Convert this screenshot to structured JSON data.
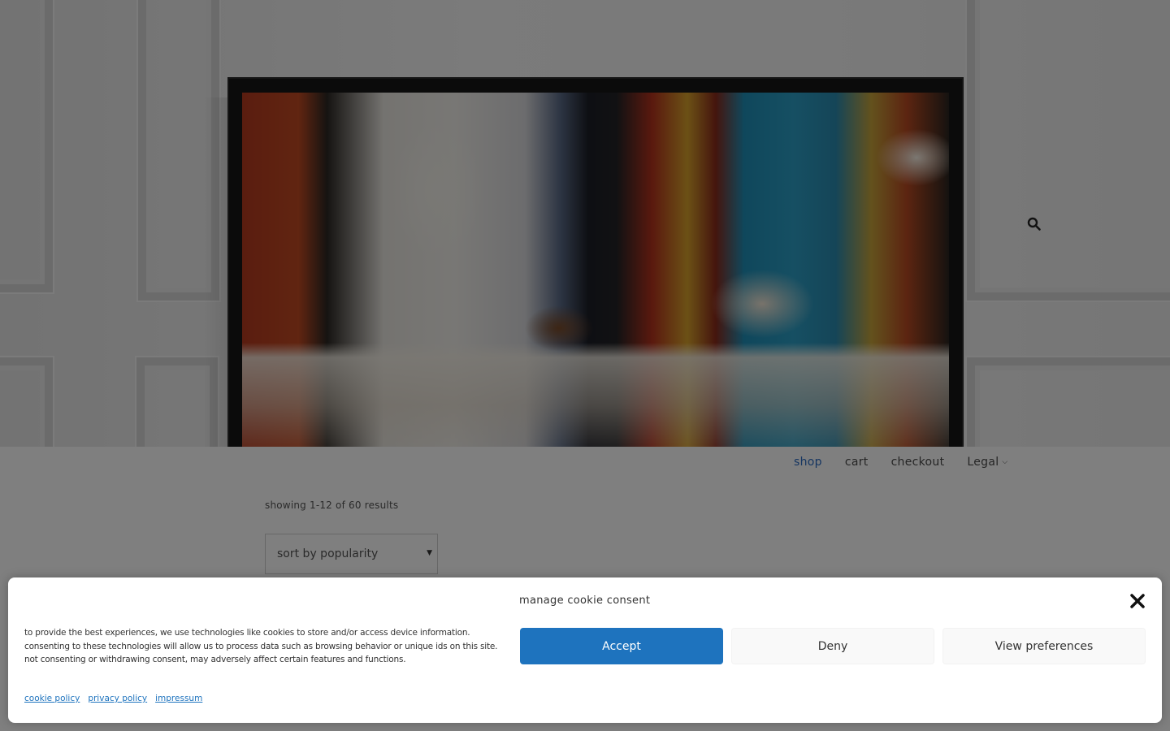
{
  "nav": {
    "items": [
      {
        "label": "shop",
        "active": true
      },
      {
        "label": "cart",
        "active": false
      },
      {
        "label": "checkout",
        "active": false
      },
      {
        "label": "Legal",
        "has_dropdown": true
      }
    ]
  },
  "shop": {
    "results_text": "showing 1-12 of 60 results",
    "sort_selected": "sort by popularity"
  },
  "cookie": {
    "title": "manage cookie consent",
    "text": "to provide the best experiences, we use technologies like cookies to store and/or access device information. consenting to these technologies will allow us to process data such as browsing behavior or unique ids on this site. not consenting or withdrawing consent, may adversely affect certain features and functions.",
    "accept": "Accept",
    "deny": "Deny",
    "preferences": "View preferences",
    "links": [
      "cookie policy",
      "privacy policy",
      "impressum"
    ]
  },
  "colors": {
    "accent": "#1e73be",
    "active_nav": "#2a6bc2"
  },
  "icons": {
    "search": "search-icon",
    "close": "close-icon",
    "dropdown": "chevron-down-icon"
  }
}
